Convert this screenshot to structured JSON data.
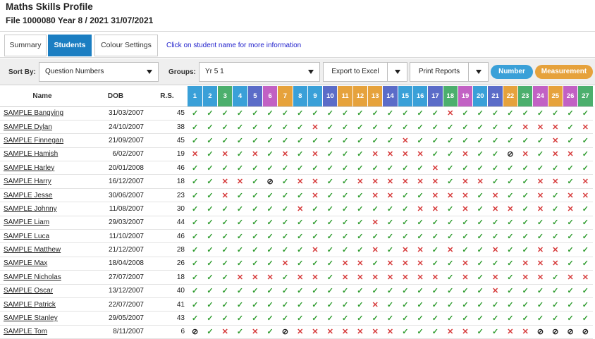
{
  "header": {
    "title": "Maths Skills Profile",
    "file_line": "File 1000080 Year 8 / 2021 31/07/2021"
  },
  "tabs": [
    {
      "label": "Summary",
      "active": false
    },
    {
      "label": "Students",
      "active": true
    },
    {
      "label": "Colour Settings",
      "active": false
    }
  ],
  "hint": "Click on student name for more information",
  "filters": {
    "sort_label": "Sort By:",
    "sort_value": "Question Numbers",
    "groups_label": "Groups:",
    "groups_value": "Yr 5 1",
    "export_label": "Export to Excel",
    "print_label": "Print Reports",
    "strands": [
      {
        "label": "Number",
        "color": "#3aa0d8"
      },
      {
        "label": "Measurement",
        "color": "#e6a23c"
      }
    ]
  },
  "table": {
    "headers": {
      "name": "Name",
      "dob": "DOB",
      "rs": "R.S."
    },
    "questions": [
      {
        "n": "1",
        "color": "#3aa0d8"
      },
      {
        "n": "2",
        "color": "#3aa0d8"
      },
      {
        "n": "3",
        "color": "#4caf6d"
      },
      {
        "n": "4",
        "color": "#3aa0d8"
      },
      {
        "n": "5",
        "color": "#5b6cc8"
      },
      {
        "n": "6",
        "color": "#c261c4"
      },
      {
        "n": "7",
        "color": "#e6a23c"
      },
      {
        "n": "8",
        "color": "#3aa0d8"
      },
      {
        "n": "9",
        "color": "#3aa0d8"
      },
      {
        "n": "10",
        "color": "#5b6cc8"
      },
      {
        "n": "11",
        "color": "#e6a23c"
      },
      {
        "n": "12",
        "color": "#e6a23c"
      },
      {
        "n": "13",
        "color": "#e6a23c"
      },
      {
        "n": "14",
        "color": "#5b6cc8"
      },
      {
        "n": "15",
        "color": "#3aa0d8"
      },
      {
        "n": "16",
        "color": "#3aa0d8"
      },
      {
        "n": "17",
        "color": "#5b6cc8"
      },
      {
        "n": "18",
        "color": "#4caf6d"
      },
      {
        "n": "19",
        "color": "#c261c4"
      },
      {
        "n": "20",
        "color": "#3aa0d8"
      },
      {
        "n": "21",
        "color": "#5b6cc8"
      },
      {
        "n": "22",
        "color": "#e6a23c"
      },
      {
        "n": "23",
        "color": "#4caf6d"
      },
      {
        "n": "24",
        "color": "#c261c4"
      },
      {
        "n": "25",
        "color": "#e6a23c"
      },
      {
        "n": "26",
        "color": "#c261c4"
      },
      {
        "n": "27",
        "color": "#4caf6d"
      }
    ],
    "symbols": {
      "y": "✓",
      "x": "✕",
      "o": "⊘"
    },
    "rows": [
      {
        "name": "SAMPLE Bangying",
        "dob": "31/03/2007",
        "rs": "45",
        "marks": "yyyyyyyyyyyyyyyyyxyyyyyyyyy"
      },
      {
        "name": "SAMPLE Dylan",
        "dob": "24/10/2007",
        "rs": "38",
        "marks": "yyyyyyyyxyyyyyyyyyyyyyxxxyx"
      },
      {
        "name": "SAMPLE Finnegan",
        "dob": "21/09/2007",
        "rs": "45",
        "marks": "yyyyyyyyyyyyyyxyyyyyyyyyxyy"
      },
      {
        "name": "SAMPLE Hamish",
        "dob": "6/02/2007",
        "rs": "19",
        "marks": "xyxyxyxyxyyyxxxxyyxyyoxyxxy"
      },
      {
        "name": "SAMPLE Harley",
        "dob": "20/01/2008",
        "rs": "46",
        "marks": "yyyyyyyyyyyyyyyyxyyyyyyyyyy"
      },
      {
        "name": "SAMPLE Harry",
        "dob": "16/12/2007",
        "rs": "18",
        "marks": "yyxxyoyxxyyxxxxxxyxxyyyxxyx"
      },
      {
        "name": "SAMPLE Jesse",
        "dob": "30/06/2007",
        "rs": "23",
        "marks": "yyxyyyyyxyyyxxyyxxxyxyyxyxx"
      },
      {
        "name": "SAMPLE Johnny",
        "dob": "11/08/2007",
        "rs": "30",
        "marks": "yyyyyyyxyyyyyyyxxyxyxxyxyxy"
      },
      {
        "name": "SAMPLE Liam",
        "dob": "29/03/2007",
        "rs": "44",
        "marks": "yyyyyyyyyyyyxyyyyyyyyyyyyyy"
      },
      {
        "name": "SAMPLE Luca",
        "dob": "11/10/2007",
        "rs": "46",
        "marks": "yyyyyyyyyyyyyyyyyyyyyyyyyyy"
      },
      {
        "name": "SAMPLE Matthew",
        "dob": "21/12/2007",
        "rs": "28",
        "marks": "yyyyyyyyxyyyxyxxyxyyxyyxxyy"
      },
      {
        "name": "SAMPLE Max",
        "dob": "18/04/2008",
        "rs": "26",
        "marks": "yyyyyyxyyyxxyxxxyyxyyyxxxyy"
      },
      {
        "name": "SAMPLE Nicholas",
        "dob": "27/07/2007",
        "rs": "18",
        "marks": "yyyxxxyxxyxxxxxxxyxyxyxxyxx"
      },
      {
        "name": "SAMPLE Oscar",
        "dob": "13/12/2007",
        "rs": "40",
        "marks": "yyyyyyyyyyyyyyyyyyyyxyyyyyy"
      },
      {
        "name": "SAMPLE Patrick",
        "dob": "22/07/2007",
        "rs": "41",
        "marks": "yyyyyyyyyyyyxyyyyyyyyyyyyyy"
      },
      {
        "name": "SAMPLE Stanley",
        "dob": "29/05/2007",
        "rs": "43",
        "marks": "yyyyyyyyyyyyyyyyyyyyyyyyyyy"
      },
      {
        "name": "SAMPLE Tom",
        "dob": "8/11/2007",
        "rs": "6",
        "marks": "oyxyxyoxxxxxxxyyyxxyyxxoooo"
      }
    ]
  }
}
